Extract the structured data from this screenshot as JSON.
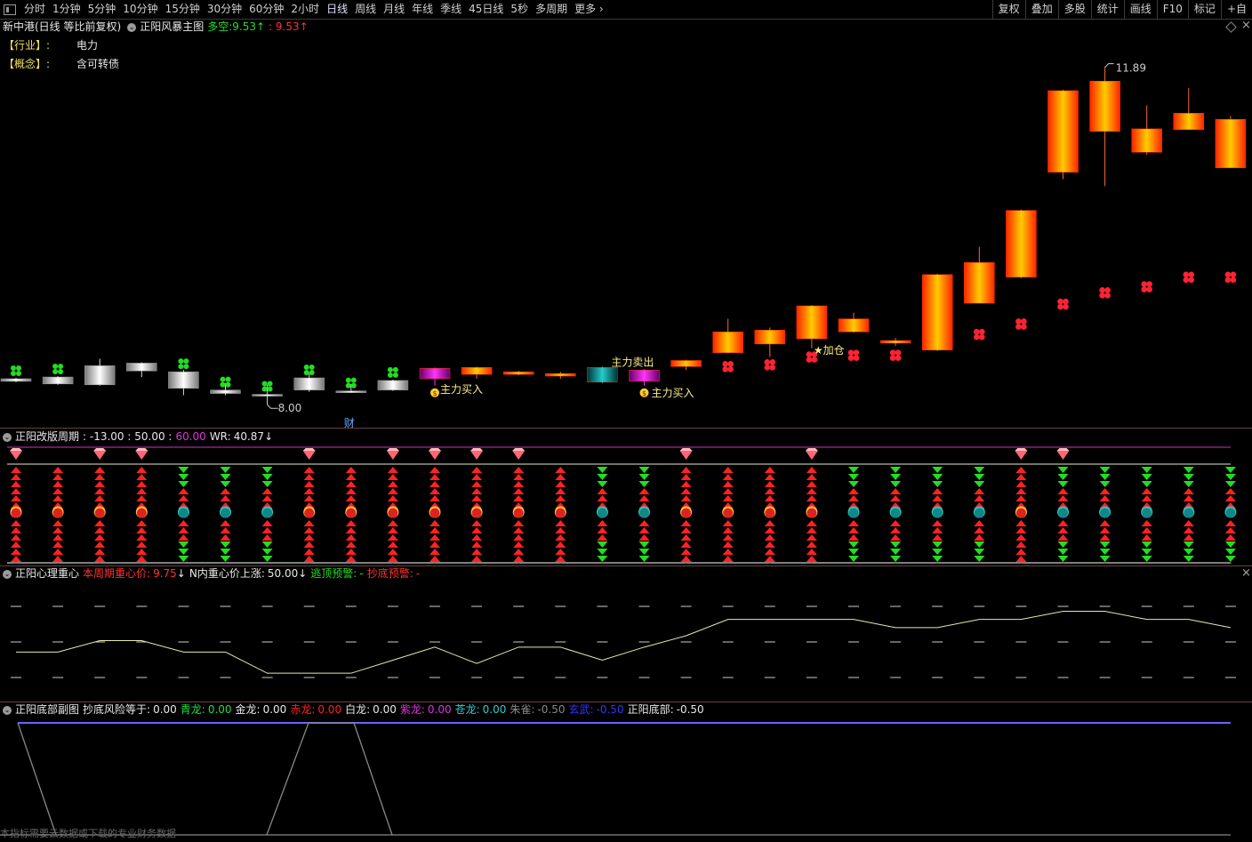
{
  "toolbar": {
    "periods": [
      "分时",
      "1分钟",
      "5分钟",
      "10分钟",
      "15分钟",
      "30分钟",
      "60分钟",
      "2小时",
      "日线",
      "周线",
      "月线",
      "年线",
      "季线",
      "45日线",
      "5秒",
      "多周期",
      "更多 ›"
    ],
    "active": "日线",
    "right": [
      "复权",
      "叠加",
      "多股",
      "统计",
      "画线",
      "F10",
      "标记",
      "+自"
    ]
  },
  "main": {
    "title": "新中港(日线 等比前复权)",
    "indicator": "正阳风暴主图",
    "duokong_label": "多空:",
    "duokong_v1": "9.53",
    "duokong_v2": ": 9.53",
    "industry_label": "【行业】:",
    "industry_value": "电力",
    "concept_label": "【概念】:",
    "concept_value": "含可转债",
    "high_label": "11.89",
    "low_label": "8.00",
    "cai_label": "财",
    "annotations": [
      "主力买入",
      "主力卖出",
      "主力买入",
      "★加仓"
    ]
  },
  "panel2": {
    "name": "正阳改版周期",
    "vals": ": -13.00  : 50.00  :",
    "v60": "60.00",
    "wr_label": "WR:",
    "wr": "40.87"
  },
  "panel3": {
    "name": "正阳心理重心",
    "c1_label": "本周期重心价:",
    "c1": "9.75",
    "c2_label": "N内重心价上涨:",
    "c2": "50.00",
    "c3_label": "逃顶预警:",
    "c3": "-",
    "c4_label": "抄底预警:",
    "c4": "-"
  },
  "panel4": {
    "name": "正阳底部副图",
    "risk_label": "抄底风险等于:",
    "risk": "0.00",
    "items": [
      {
        "label": "青龙:",
        "value": "0.00",
        "color": "#22dd44"
      },
      {
        "label": "金龙:",
        "value": "0.00",
        "color": "#e8e8e8"
      },
      {
        "label": "赤龙:",
        "value": "0.00",
        "color": "#ff2222"
      },
      {
        "label": "白龙:",
        "value": "0.00",
        "color": "#e8e8e8"
      },
      {
        "label": "紫龙:",
        "value": "0.00",
        "color": "#dd33dd"
      },
      {
        "label": "苍龙:",
        "value": "0.00",
        "color": "#33cccc"
      },
      {
        "label": "朱雀:",
        "value": "-0.50",
        "color": "#888888"
      },
      {
        "label": "玄武:",
        "value": "-0.50",
        "color": "#3333ff"
      },
      {
        "label": "正阳底部:",
        "value": "-0.50",
        "color": "#e8e8e8"
      }
    ]
  },
  "footer": "本指标需要云数据或下载的专业财务数据",
  "colors": {
    "up": "#ff3300",
    "down": "#cccccc",
    "purple": "#cc33cc",
    "teal": "#22aaaa",
    "green": "#22dd22",
    "red": "#ff2222"
  },
  "chart_data": {
    "type": "candlestick",
    "ylim": [
      7.9,
      12.05
    ],
    "candles": [
      {
        "o": 8.3,
        "c": 8.27,
        "h": 8.31,
        "l": 8.26,
        "kind": "down"
      },
      {
        "o": 8.32,
        "c": 8.24,
        "h": 8.33,
        "l": 8.23,
        "kind": "down"
      },
      {
        "o": 8.45,
        "c": 8.23,
        "h": 8.53,
        "l": 8.22,
        "kind": "down"
      },
      {
        "o": 8.48,
        "c": 8.39,
        "h": 8.49,
        "l": 8.32,
        "kind": "down"
      },
      {
        "o": 8.38,
        "c": 8.19,
        "h": 8.4,
        "l": 8.11,
        "kind": "down"
      },
      {
        "o": 8.17,
        "c": 8.13,
        "h": 8.25,
        "l": 8.11,
        "kind": "down"
      },
      {
        "o": 8.12,
        "c": 8.1,
        "h": 8.23,
        "l": 8.0,
        "kind": "down"
      },
      {
        "o": 8.31,
        "c": 8.17,
        "h": 8.36,
        "l": 8.15,
        "kind": "down"
      },
      {
        "o": 8.16,
        "c": 8.15,
        "h": 8.24,
        "l": 8.14,
        "kind": "down"
      },
      {
        "o": 8.28,
        "c": 8.17,
        "h": 8.29,
        "l": 8.16,
        "kind": "down"
      },
      {
        "o": 8.3,
        "c": 8.42,
        "h": 8.43,
        "l": 8.22,
        "kind": "purple"
      },
      {
        "o": 8.35,
        "c": 8.43,
        "h": 8.44,
        "l": 8.3,
        "kind": "up"
      },
      {
        "o": 8.35,
        "c": 8.38,
        "h": 8.39,
        "l": 8.34,
        "kind": "up"
      },
      {
        "o": 8.33,
        "c": 8.36,
        "h": 8.38,
        "l": 8.3,
        "kind": "up"
      },
      {
        "o": 8.43,
        "c": 8.26,
        "h": 8.44,
        "l": 8.25,
        "kind": "teal"
      },
      {
        "o": 8.27,
        "c": 8.4,
        "h": 8.41,
        "l": 8.22,
        "kind": "purple"
      },
      {
        "o": 8.44,
        "c": 8.51,
        "h": 8.52,
        "l": 8.4,
        "kind": "up"
      },
      {
        "o": 8.6,
        "c": 8.84,
        "h": 8.99,
        "l": 8.59,
        "kind": "up"
      },
      {
        "o": 8.7,
        "c": 8.86,
        "h": 8.89,
        "l": 8.55,
        "kind": "up"
      },
      {
        "o": 8.76,
        "c": 9.14,
        "h": 9.15,
        "l": 8.65,
        "kind": "up"
      },
      {
        "o": 8.84,
        "c": 8.99,
        "h": 9.06,
        "l": 8.83,
        "kind": "up"
      },
      {
        "o": 8.71,
        "c": 8.74,
        "h": 8.77,
        "l": 8.68,
        "kind": "up"
      },
      {
        "o": 8.63,
        "c": 9.5,
        "h": 9.51,
        "l": 8.62,
        "kind": "up"
      },
      {
        "o": 9.17,
        "c": 9.64,
        "h": 9.82,
        "l": 9.17,
        "kind": "up"
      },
      {
        "o": 9.47,
        "c": 10.24,
        "h": 10.25,
        "l": 9.46,
        "kind": "up"
      },
      {
        "o": 10.68,
        "c": 11.62,
        "h": 11.63,
        "l": 10.6,
        "kind": "up"
      },
      {
        "o": 11.15,
        "c": 11.73,
        "h": 11.89,
        "l": 10.52,
        "kind": "up"
      },
      {
        "o": 10.91,
        "c": 11.18,
        "h": 11.45,
        "l": 10.88,
        "kind": "up"
      },
      {
        "o": 11.17,
        "c": 11.36,
        "h": 11.65,
        "l": 11.17,
        "kind": "up"
      },
      {
        "o": 10.73,
        "c": 11.29,
        "h": 11.33,
        "l": 10.73,
        "kind": "up"
      }
    ],
    "markers_below": [
      {
        "i": 17,
        "v": 8.44
      },
      {
        "i": 18,
        "v": 8.46
      },
      {
        "i": 19,
        "v": 8.55
      },
      {
        "i": 20,
        "v": 8.57
      },
      {
        "i": 21,
        "v": 8.57
      },
      {
        "i": 23,
        "v": 8.81
      },
      {
        "i": 24,
        "v": 8.93
      },
      {
        "i": 25,
        "v": 9.16
      },
      {
        "i": 26,
        "v": 9.29
      },
      {
        "i": 27,
        "v": 9.36
      },
      {
        "i": 28,
        "v": 9.47
      },
      {
        "i": 29,
        "v": 9.47
      }
    ],
    "clovers_above": [
      0,
      1,
      4,
      5,
      6,
      7,
      8,
      9
    ],
    "heart_line": [
      8.55,
      8.55,
      8.62,
      8.62,
      8.55,
      8.55,
      8.42,
      8.42,
      8.42,
      8.5,
      8.58,
      8.48,
      8.58,
      8.58,
      8.5,
      8.58,
      8.65,
      8.75,
      8.75,
      8.75,
      8.75,
      8.7,
      8.7,
      8.75,
      8.75,
      8.8,
      8.8,
      8.75,
      8.75,
      8.7
    ]
  }
}
